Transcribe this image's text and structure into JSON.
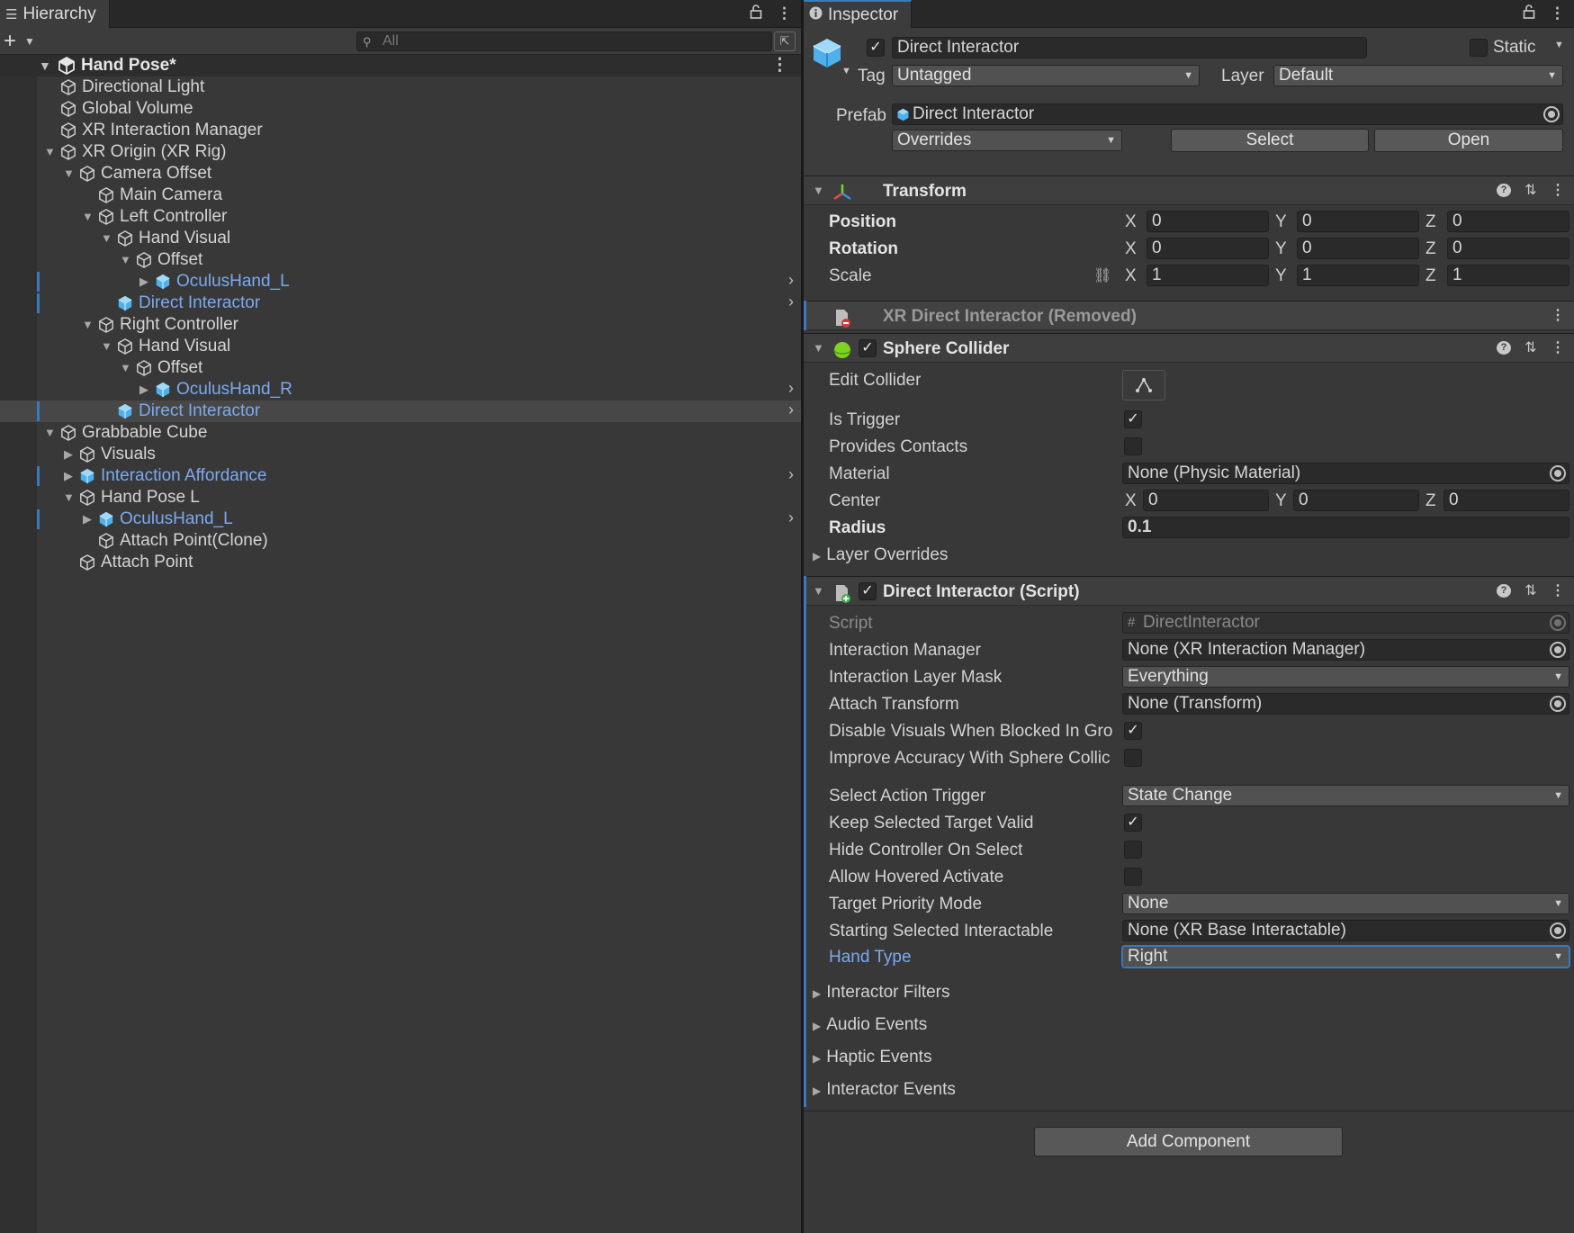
{
  "hierarchy": {
    "tab_title": "Hierarchy",
    "add_button": "+",
    "search_placeholder": "All",
    "scene_name": "Hand Pose*",
    "items": [
      {
        "label": "Directional Light",
        "depth": 1,
        "arrow": "",
        "prefab": false,
        "selected": false,
        "override": false,
        "chevron": false
      },
      {
        "label": "Global Volume",
        "depth": 1,
        "arrow": "",
        "prefab": false,
        "selected": false,
        "override": false,
        "chevron": false
      },
      {
        "label": "XR Interaction Manager",
        "depth": 1,
        "arrow": "",
        "prefab": false,
        "selected": false,
        "override": false,
        "chevron": false
      },
      {
        "label": "XR Origin (XR Rig)",
        "depth": 1,
        "arrow": "down",
        "prefab": false,
        "selected": false,
        "override": false,
        "chevron": false
      },
      {
        "label": "Camera Offset",
        "depth": 2,
        "arrow": "down",
        "prefab": false,
        "selected": false,
        "override": false,
        "chevron": false
      },
      {
        "label": "Main Camera",
        "depth": 3,
        "arrow": "",
        "prefab": false,
        "selected": false,
        "override": false,
        "chevron": false
      },
      {
        "label": "Left Controller",
        "depth": 3,
        "arrow": "down",
        "prefab": false,
        "selected": false,
        "override": false,
        "chevron": false
      },
      {
        "label": "Hand Visual",
        "depth": 4,
        "arrow": "down",
        "prefab": false,
        "selected": false,
        "override": false,
        "chevron": false
      },
      {
        "label": "Offset",
        "depth": 5,
        "arrow": "down",
        "prefab": false,
        "selected": false,
        "override": false,
        "chevron": false
      },
      {
        "label": "OculusHand_L",
        "depth": 6,
        "arrow": "right",
        "prefab": true,
        "selected": false,
        "override": true,
        "chevron": true
      },
      {
        "label": "Direct Interactor",
        "depth": 4,
        "arrow": "",
        "prefab": true,
        "selected": false,
        "override": true,
        "chevron": true
      },
      {
        "label": "Right Controller",
        "depth": 3,
        "arrow": "down",
        "prefab": false,
        "selected": false,
        "override": false,
        "chevron": false
      },
      {
        "label": "Hand Visual",
        "depth": 4,
        "arrow": "down",
        "prefab": false,
        "selected": false,
        "override": false,
        "chevron": false
      },
      {
        "label": "Offset",
        "depth": 5,
        "arrow": "down",
        "prefab": false,
        "selected": false,
        "override": false,
        "chevron": false
      },
      {
        "label": "OculusHand_R",
        "depth": 6,
        "arrow": "right",
        "prefab": true,
        "selected": false,
        "override": false,
        "chevron": true
      },
      {
        "label": "Direct Interactor",
        "depth": 4,
        "arrow": "",
        "prefab": true,
        "selected": true,
        "override": true,
        "chevron": true
      },
      {
        "label": "Grabbable Cube",
        "depth": 1,
        "arrow": "down",
        "prefab": false,
        "selected": false,
        "override": false,
        "chevron": false
      },
      {
        "label": "Visuals",
        "depth": 2,
        "arrow": "right",
        "prefab": false,
        "selected": false,
        "override": false,
        "chevron": false
      },
      {
        "label": "Interaction Affordance",
        "depth": 2,
        "arrow": "right",
        "prefab": true,
        "selected": false,
        "override": true,
        "chevron": true
      },
      {
        "label": "Hand Pose L",
        "depth": 2,
        "arrow": "down",
        "prefab": false,
        "selected": false,
        "override": false,
        "chevron": false
      },
      {
        "label": "OculusHand_L",
        "depth": 3,
        "arrow": "right",
        "prefab": true,
        "selected": false,
        "override": true,
        "chevron": true
      },
      {
        "label": "Attach Point(Clone)",
        "depth": 3,
        "arrow": "",
        "prefab": false,
        "selected": false,
        "override": false,
        "chevron": false
      },
      {
        "label": "Attach Point",
        "depth": 2,
        "arrow": "",
        "prefab": false,
        "selected": false,
        "override": false,
        "chevron": false
      }
    ]
  },
  "inspector": {
    "tab_title": "Inspector",
    "object_name": "Direct Interactor",
    "static_label": "Static",
    "tag_label": "Tag",
    "tag_value": "Untagged",
    "layer_label": "Layer",
    "layer_value": "Default",
    "prefab_label": "Prefab",
    "prefab_value": "Direct Interactor",
    "overrides_label": "Overrides",
    "select_label": "Select",
    "open_label": "Open",
    "transform": {
      "title": "Transform",
      "position_label": "Position",
      "rotation_label": "Rotation",
      "scale_label": "Scale",
      "axis_x": "X",
      "axis_y": "Y",
      "axis_z": "Z",
      "position": [
        "0",
        "0",
        "0"
      ],
      "rotation": [
        "0",
        "0",
        "0"
      ],
      "scale": [
        "1",
        "1",
        "1"
      ]
    },
    "removed_component_title": "XR Direct Interactor (Removed)",
    "sphere_collider": {
      "title": "Sphere Collider",
      "edit_collider_label": "Edit Collider",
      "is_trigger_label": "Is Trigger",
      "is_trigger": true,
      "provides_contacts_label": "Provides Contacts",
      "provides_contacts": false,
      "material_label": "Material",
      "material_value": "None (Physic Material)",
      "center_label": "Center",
      "center": [
        "0",
        "0",
        "0"
      ],
      "radius_label": "Radius",
      "radius_value": "0.1",
      "layer_overrides_label": "Layer Overrides"
    },
    "direct_interactor": {
      "title": "Direct Interactor (Script)",
      "script_label": "Script",
      "script_value": "DirectInteractor",
      "interaction_manager_label": "Interaction Manager",
      "interaction_manager_value": "None (XR Interaction Manager)",
      "layer_mask_label": "Interaction Layer Mask",
      "layer_mask_value": "Everything",
      "attach_transform_label": "Attach Transform",
      "attach_transform_value": "None (Transform)",
      "disable_visuals_label": "Disable Visuals When Blocked In Gro",
      "disable_visuals": true,
      "improve_accuracy_label": "Improve Accuracy With Sphere Collic",
      "improve_accuracy": false,
      "select_action_trigger_label": "Select Action Trigger",
      "select_action_trigger_value": "State Change",
      "keep_selected_label": "Keep Selected Target Valid",
      "keep_selected": true,
      "hide_controller_label": "Hide Controller On Select",
      "hide_controller": false,
      "allow_hovered_label": "Allow Hovered Activate",
      "allow_hovered": false,
      "target_priority_label": "Target Priority Mode",
      "target_priority_value": "None",
      "starting_selected_label": "Starting Selected Interactable",
      "starting_selected_value": "None (XR Base Interactable)",
      "hand_type_label": "Hand Type",
      "hand_type_value": "Right",
      "interactor_filters_label": "Interactor Filters",
      "audio_events_label": "Audio Events",
      "haptic_events_label": "Haptic Events",
      "interactor_events_label": "Interactor Events"
    },
    "add_component_label": "Add Component"
  },
  "colors": {
    "prefab_blue": "#7baaf0",
    "accent_blue": "#3a79bb",
    "panel_bg": "#383838"
  },
  "icons": {
    "hierarchy_tab": "list-icon",
    "inspector_tab": "info-icon",
    "lock": "lock-icon",
    "menu": "kebab-menu-icon",
    "gameobject": "cube-outline-icon",
    "prefab": "blue-cube-icon"
  }
}
